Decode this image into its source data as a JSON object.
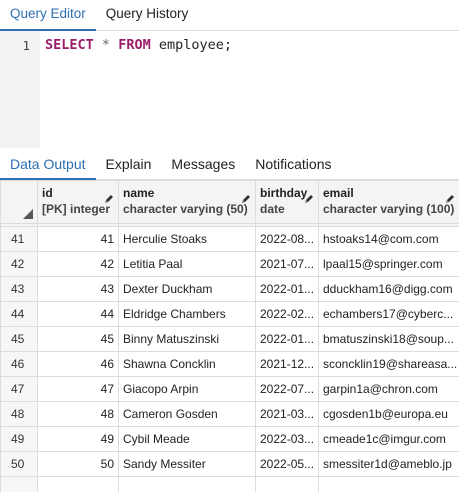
{
  "editor_tabs": [
    {
      "label": "Query Editor",
      "active": true
    },
    {
      "label": "Query History",
      "active": false
    }
  ],
  "query": {
    "line_number": "1",
    "tokens": {
      "select": "SELECT",
      "star": "*",
      "from": "FROM",
      "rest": "employee;"
    }
  },
  "output_tabs": [
    {
      "label": "Data Output",
      "active": true
    },
    {
      "label": "Explain",
      "active": false
    },
    {
      "label": "Messages",
      "active": false
    },
    {
      "label": "Notifications",
      "active": false
    }
  ],
  "columns": [
    {
      "name": "id",
      "type": "[PK] integer"
    },
    {
      "name": "name",
      "type": "character varying (50)"
    },
    {
      "name": "birthday",
      "type": "date"
    },
    {
      "name": "email",
      "type": "character varying (100)"
    }
  ],
  "rows": [
    {
      "row": "41",
      "id": "41",
      "name": "Herculie Stoaks",
      "birthday": "2022-08...",
      "email": "hstoaks14@com.com"
    },
    {
      "row": "42",
      "id": "42",
      "name": "Letitia Paal",
      "birthday": "2021-07...",
      "email": "lpaal15@springer.com"
    },
    {
      "row": "43",
      "id": "43",
      "name": "Dexter Duckham",
      "birthday": "2022-01...",
      "email": "dduckham16@digg.com"
    },
    {
      "row": "44",
      "id": "44",
      "name": "Eldridge Chambers",
      "birthday": "2022-02...",
      "email": "echambers17@cyberc..."
    },
    {
      "row": "45",
      "id": "45",
      "name": "Binny Matuszinski",
      "birthday": "2022-01...",
      "email": "bmatuszinski18@soup..."
    },
    {
      "row": "46",
      "id": "46",
      "name": "Shawna Concklin",
      "birthday": "2021-12...",
      "email": "sconcklin19@shareasa..."
    },
    {
      "row": "47",
      "id": "47",
      "name": "Giacopo Arpin",
      "birthday": "2022-07...",
      "email": "garpin1a@chron.com"
    },
    {
      "row": "48",
      "id": "48",
      "name": "Cameron Gosden",
      "birthday": "2021-03...",
      "email": "cgosden1b@europa.eu"
    },
    {
      "row": "49",
      "id": "49",
      "name": "Cybil Meade",
      "birthday": "2022-03...",
      "email": "cmeade1c@imgur.com"
    },
    {
      "row": "50",
      "id": "50",
      "name": "Sandy Messiter",
      "birthday": "2022-05...",
      "email": "smessiter1d@ameblo.jp"
    }
  ],
  "colors": {
    "accent": "#2c6fb3",
    "keyword": "#9b1d6a"
  }
}
